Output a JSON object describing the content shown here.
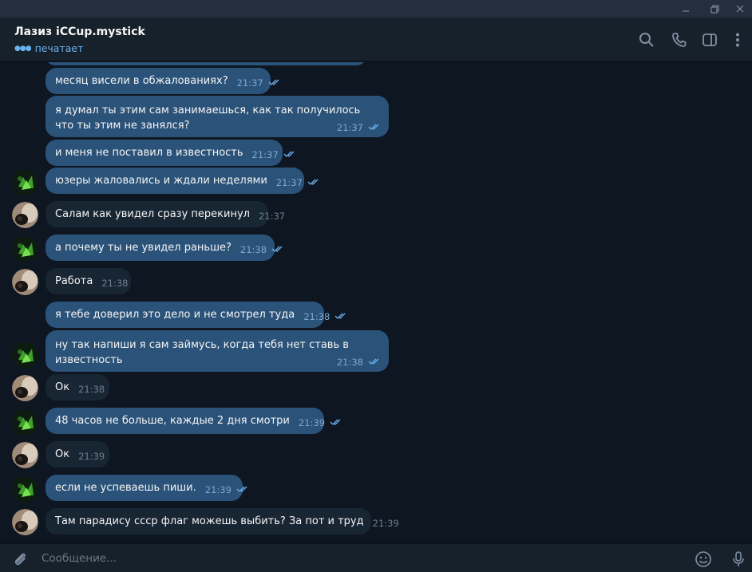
{
  "window": {
    "controls": [
      "minimize",
      "restore",
      "close"
    ]
  },
  "header": {
    "title": "Лазиз iCCup.mystick",
    "status": "печатает",
    "icons": [
      "search-icon",
      "phone-icon",
      "sidebar-toggle-icon",
      "more-vert-icon"
    ]
  },
  "messages": [
    {
      "dir": "out",
      "text": "месяц висели в обжалованиях?",
      "time": "21:37",
      "read": true
    },
    {
      "dir": "out",
      "text": "я думал ты этим сам занимаешься, как так получилось что ты этим не занялся?",
      "time": "21:37",
      "read": true
    },
    {
      "dir": "out",
      "text": "и меня не поставил в известность",
      "time": "21:37",
      "read": true
    },
    {
      "dir": "out",
      "text": "юзеры жаловались и ждали неделями",
      "time": "21:37",
      "read": true
    },
    {
      "dir": "in",
      "text": "Салам как увидел сразу перекинул",
      "time": "21:37"
    },
    {
      "dir": "out",
      "text": "а почему ты не увидел раньше?",
      "time": "21:38",
      "read": true
    },
    {
      "dir": "in",
      "text": "Работа",
      "time": "21:38"
    },
    {
      "dir": "out",
      "text": "я тебе доверил это дело и не смотрел туда",
      "time": "21:38",
      "read": true
    },
    {
      "dir": "out",
      "text": "ну так напиши я сам займусь, когда тебя нет ставь в известность",
      "time": "21:38",
      "read": true
    },
    {
      "dir": "in",
      "text": "Ок",
      "time": "21:38"
    },
    {
      "dir": "out",
      "text": "48 часов не больше, каждые 2 дня смотри",
      "time": "21:39",
      "read": true
    },
    {
      "dir": "in",
      "text": "Ок",
      "time": "21:39"
    },
    {
      "dir": "out",
      "text": "если не успеваешь пиши.",
      "time": "21:39",
      "read": true
    },
    {
      "dir": "in",
      "text": "Там парадису ссср флаг можешь выбить? За пот и труд",
      "time": "21:39"
    }
  ],
  "composer": {
    "placeholder": "Сообщение...",
    "icons": [
      "attach-icon",
      "emoji-icon",
      "microphone-icon"
    ]
  },
  "colors": {
    "background": "#0e1621",
    "header": "#17212b",
    "outgoing_bubble": "#2b5278",
    "incoming_bubble": "#182533",
    "accent": "#6ab3f3",
    "read_check": "#6ab3f3"
  }
}
